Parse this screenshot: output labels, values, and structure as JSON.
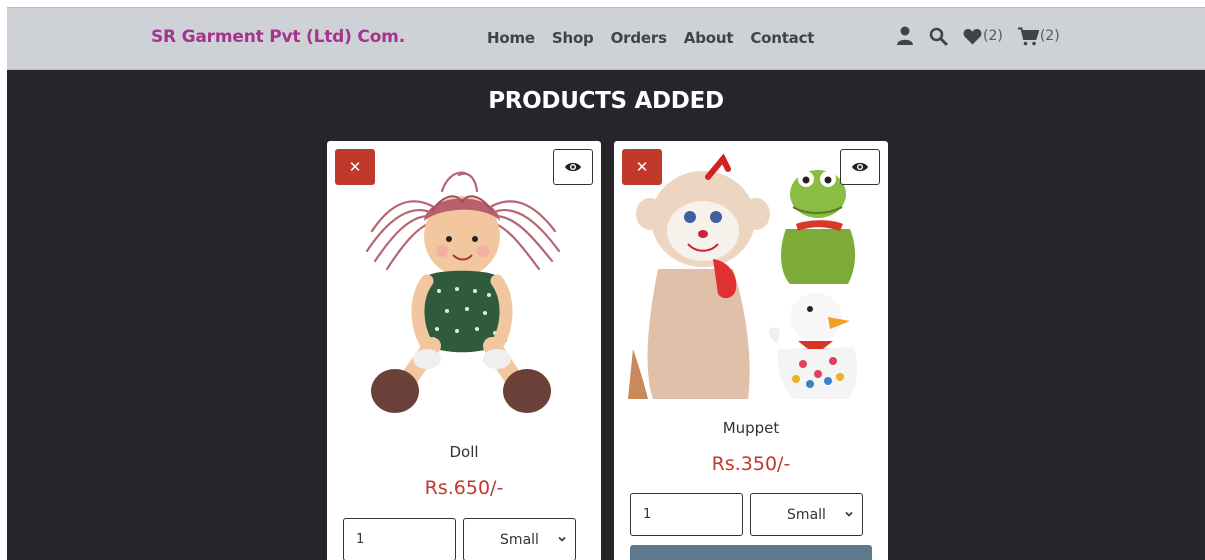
{
  "navbar": {
    "brand": "SR Garment Pvt (Ltd) Com.",
    "links": [
      "Home",
      "Shop",
      "Orders",
      "About",
      "Contact"
    ],
    "wishlist_count": "(2)",
    "cart_count": "(2)"
  },
  "main": {
    "title": "PRODUCTS ADDED"
  },
  "products": [
    {
      "name": "Doll",
      "price": "Rs.650/-",
      "quantity": "1",
      "size": "Small"
    },
    {
      "name": "Muppet",
      "price": "Rs.350/-",
      "quantity": "1",
      "size": "Small"
    }
  ],
  "icons": {
    "remove": "close-icon",
    "view": "eye-icon",
    "user": "user-icon",
    "search": "search-icon",
    "wishlist": "heart-icon",
    "cart": "cart-icon"
  },
  "colors": {
    "brand": "#a3358c",
    "navbar_bg": "#ced2d7",
    "page_bg": "#26252b",
    "remove_button": "#c0392b",
    "price": "#c0392b",
    "action_button": "#5d7a8c"
  }
}
